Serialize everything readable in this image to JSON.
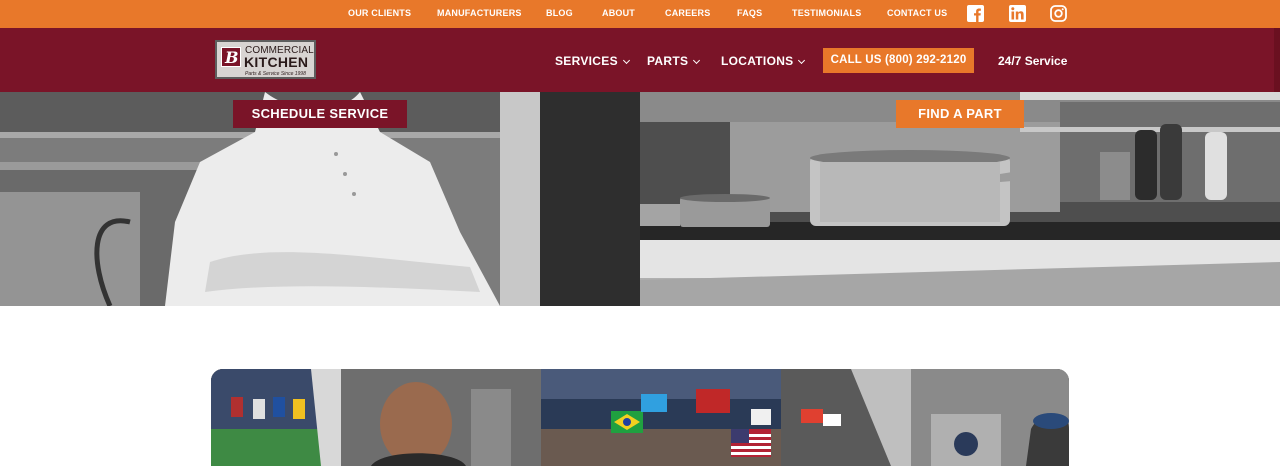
{
  "topbar": {
    "links": [
      "OUR CLIENTS",
      "MANUFACTURERS",
      "BLOG",
      "ABOUT",
      "CAREERS",
      "FAQS",
      "TESTIMONIALS",
      "CONTACT US"
    ],
    "social": [
      "facebook-icon",
      "linkedin-icon",
      "instagram-icon"
    ]
  },
  "header": {
    "logo": {
      "line1": "COMMERCIAL",
      "line2": "KITCHEN",
      "tagline": "Parts & Service Since 1998"
    },
    "nav": [
      "SERVICES",
      "PARTS",
      "LOCATIONS"
    ],
    "call_button": "CALL US (800) 292-2120",
    "service_247": "24/7 Service"
  },
  "hero": {
    "schedule_button": "SCHEDULE SERVICE",
    "find_part_button": "FIND A PART"
  },
  "colors": {
    "orange": "#e8782a",
    "maroon": "#7a1428"
  }
}
